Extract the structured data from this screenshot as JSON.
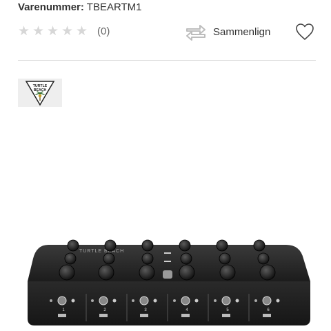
{
  "product": {
    "sku_label": "Varenummer:",
    "sku_value": "TBEARTM1"
  },
  "rating": {
    "stars": 0,
    "max_stars": 5,
    "count": "(0)"
  },
  "compare": {
    "label": "Sammenlign",
    "icon": "compare-arrows-icon"
  },
  "wishlist": {
    "icon": "heart-icon"
  },
  "brand": {
    "name": "TURTLE BEACH"
  },
  "image": {
    "channel_numbers": [
      "1",
      "2",
      "3",
      "4",
      "5",
      "6"
    ]
  },
  "colors": {
    "star_empty": "#d7d7d7",
    "text": "#333333",
    "divider": "#dcdcdc",
    "device_body": "#222222"
  }
}
